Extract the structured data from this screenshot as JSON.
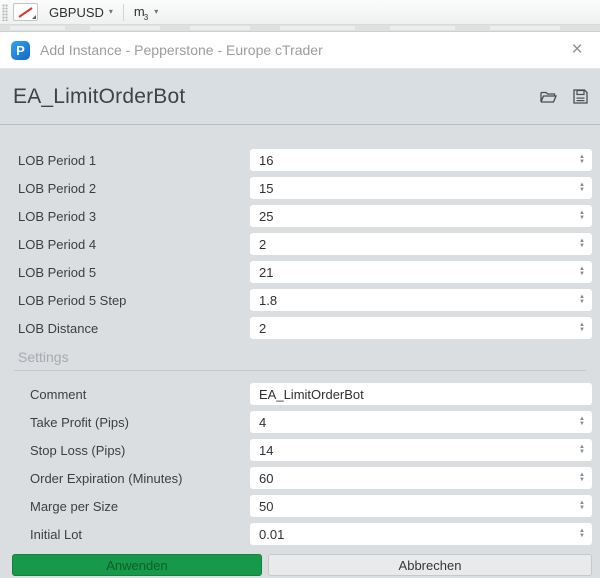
{
  "toolbar": {
    "symbol": "GBPUSD",
    "symbol_caret": "▾",
    "timeframe_base": "m",
    "timeframe_sub": "3",
    "timeframe_caret": "▾"
  },
  "dialog": {
    "title": "Add Instance - Pepperstone - Europe cTrader",
    "close_label": "×",
    "logo_letter": "P",
    "bot_name": "EA_LimitOrderBot",
    "header_icons": [
      "open-folder-icon",
      "save-icon"
    ]
  },
  "parameters": [
    {
      "label": "LOB Period 1",
      "value": "16",
      "type": "number"
    },
    {
      "label": "LOB Period 2",
      "value": "15",
      "type": "number"
    },
    {
      "label": "LOB Period 3",
      "value": "25",
      "type": "number"
    },
    {
      "label": "LOB Period 4",
      "value": "2",
      "type": "number"
    },
    {
      "label": "LOB Period 5",
      "value": "21",
      "type": "number"
    },
    {
      "label": "LOB Period 5 Step",
      "value": "1.8",
      "type": "number"
    },
    {
      "label": "LOB Distance",
      "value": "2",
      "type": "number"
    }
  ],
  "settings_section": {
    "title": "Settings",
    "fields": [
      {
        "label": "Comment",
        "value": "EA_LimitOrderBot",
        "type": "text"
      },
      {
        "label": "Take Profit (Pips)",
        "value": "4",
        "type": "number"
      },
      {
        "label": "Stop Loss (Pips)",
        "value": "14",
        "type": "number"
      },
      {
        "label": "Order Expiration (Minutes)",
        "value": "60",
        "type": "number"
      },
      {
        "label": "Marge per Size",
        "value": "50",
        "type": "number"
      },
      {
        "label": "Initial Lot",
        "value": "0.01",
        "type": "number"
      }
    ]
  },
  "buttons": {
    "apply": "Anwenden",
    "cancel": "Abbrechen"
  },
  "colors": {
    "accent_green": "#17984a",
    "header_band": "#d8dee2",
    "form_background": "#dadee1",
    "logo_blue": "#1565c8"
  }
}
